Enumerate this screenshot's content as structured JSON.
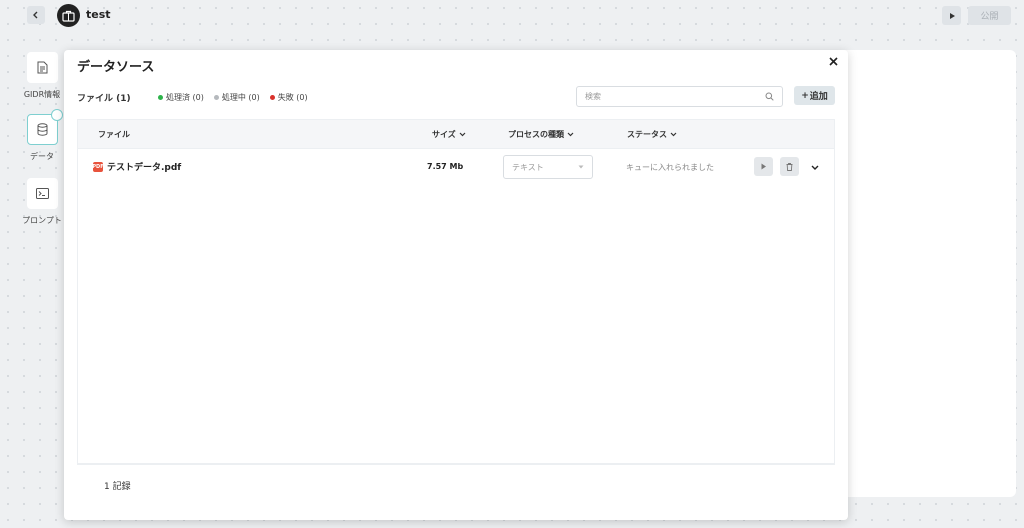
{
  "app": {
    "title": "test"
  },
  "header": {
    "publish_label": "公開"
  },
  "rail": {
    "items": [
      {
        "label": "GIDR情報",
        "icon": "document-icon"
      },
      {
        "label": "データ",
        "icon": "database-icon"
      },
      {
        "label": "プロンプト",
        "icon": "terminal-icon"
      }
    ]
  },
  "modal": {
    "title": "データソース",
    "files_label": "ファイル (1)",
    "legend": [
      {
        "label": "処理済 (0)",
        "color": "#2db34a"
      },
      {
        "label": "処理中 (0)",
        "color": "#b5b9bd"
      },
      {
        "label": "失敗 (0)",
        "color": "#d9312b"
      }
    ],
    "search": {
      "placeholder": "検索"
    },
    "add_label": "追加",
    "columns": {
      "file": "ファイル",
      "size": "サイズ",
      "process_type": "プロセスの種類",
      "status": "ステータス"
    },
    "rows": [
      {
        "file": "テストデータ.pdf",
        "size": "7.57 Mb",
        "process_type": "テキスト",
        "status": "キューに入れられました"
      }
    ],
    "record_count": "1 記録"
  }
}
